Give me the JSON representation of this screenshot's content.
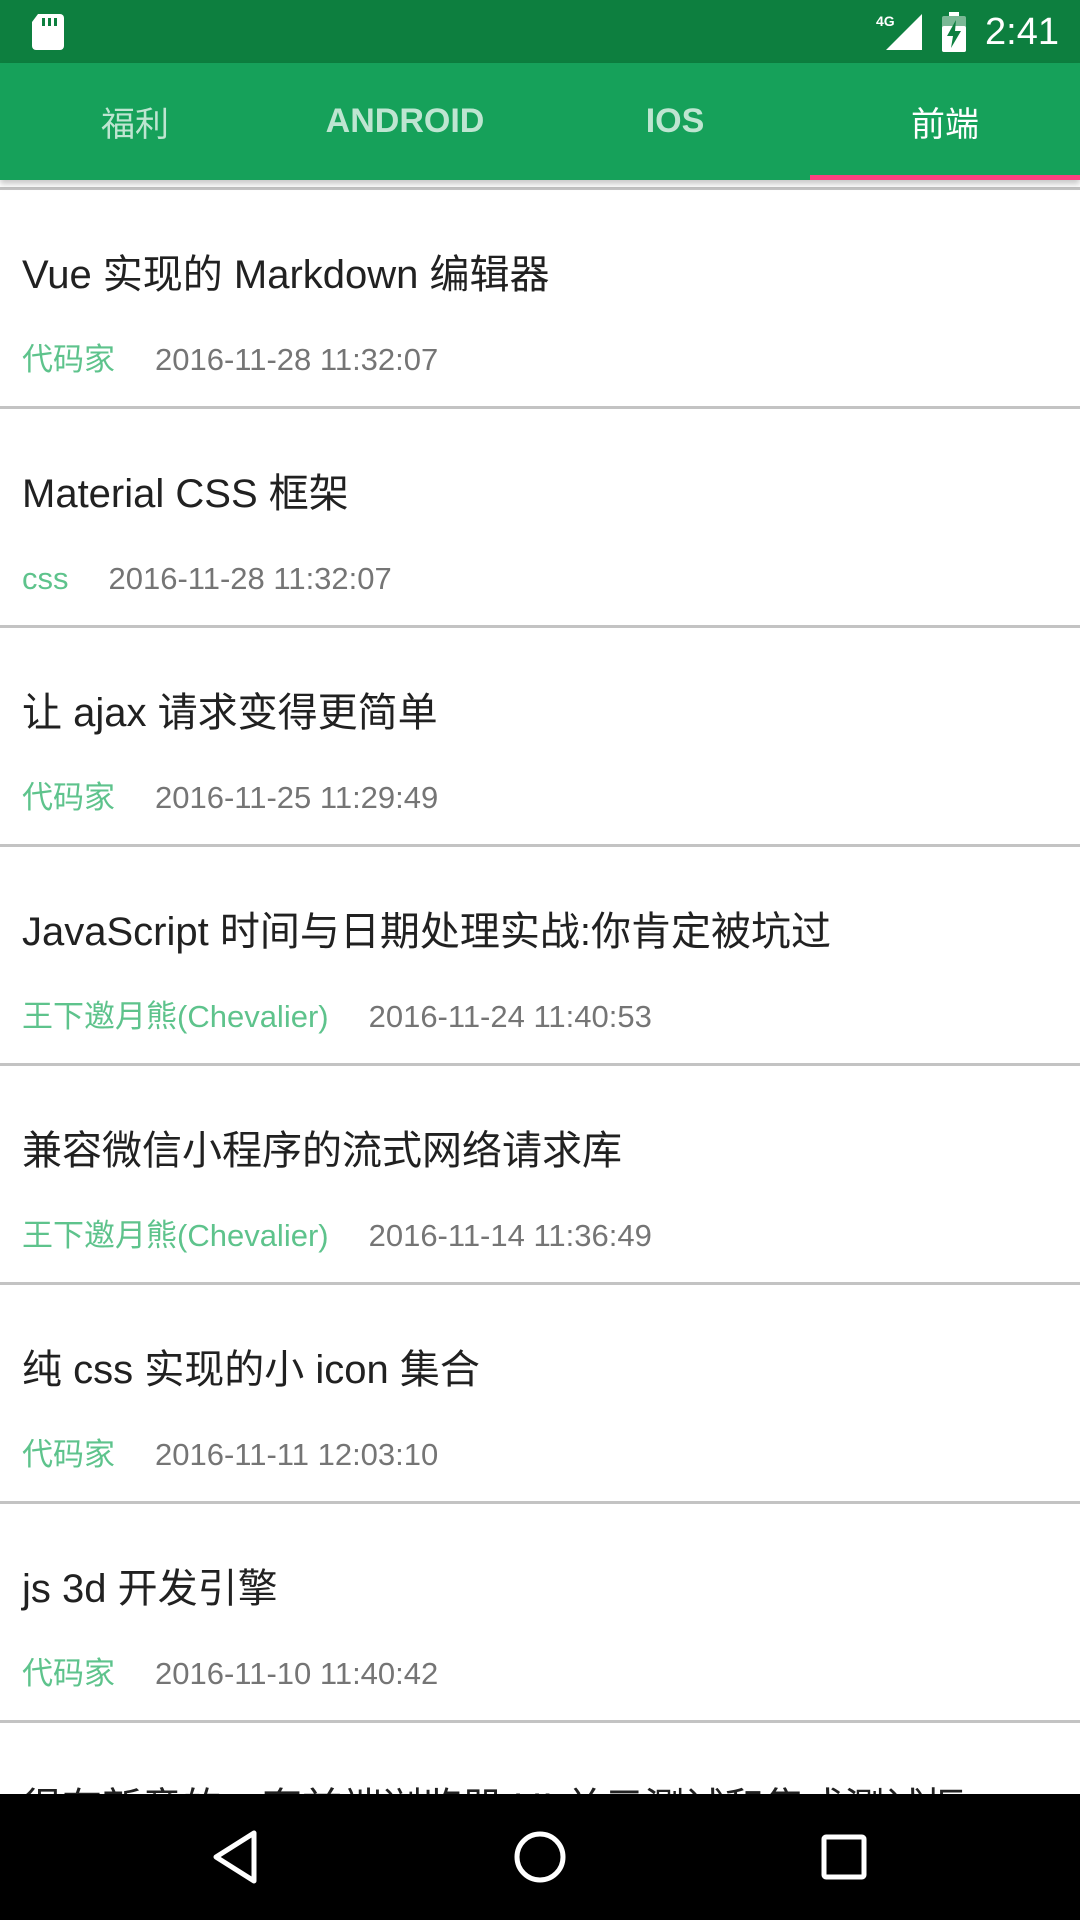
{
  "status_bar": {
    "time": "2:41",
    "network_label": "4G",
    "icons": [
      "sd-card-icon",
      "signal-4g-icon",
      "battery-charging-icon"
    ],
    "background": "#0d7f3f"
  },
  "tabs": [
    {
      "label": "福利",
      "selected": false
    },
    {
      "label": "ANDROID",
      "selected": false
    },
    {
      "label": "IOS",
      "selected": false
    },
    {
      "label": "前端",
      "selected": true
    }
  ],
  "colors": {
    "tab_bar": "#16a15a",
    "indicator": "#ff4081",
    "author": "#5ec38c",
    "date": "#757575",
    "title": "#212121"
  },
  "items": [
    {
      "title": "Vue 实现的 Markdown 编辑器",
      "author": "代码家",
      "date": "2016-11-28 11:32:07"
    },
    {
      "title": "Material CSS 框架",
      "author": "css",
      "date": "2016-11-28 11:32:07"
    },
    {
      "title": "让 ajax 请求变得更简单",
      "author": "代码家",
      "date": "2016-11-25 11:29:49"
    },
    {
      "title": "JavaScript 时间与日期处理实战:你肯定被坑过",
      "author": "王下邀月熊(Chevalier)",
      "date": "2016-11-24 11:40:53"
    },
    {
      "title": "兼容微信小程序的流式网络请求库",
      "author": "王下邀月熊(Chevalier)",
      "date": "2016-11-14 11:36:49"
    },
    {
      "title": "纯 css 实现的小 icon 集合",
      "author": "代码家",
      "date": "2016-11-11 12:03:10"
    },
    {
      "title": "js 3d 开发引擎",
      "author": "代码家",
      "date": "2016-11-10 11:40:42"
    },
    {
      "title": "很有新意的一套前端浏览器 UI 单元测试和集成测试框",
      "author": "",
      "date": ""
    }
  ],
  "nav_bar": {
    "icons": [
      "back-icon",
      "home-icon",
      "recent-apps-icon"
    ]
  }
}
